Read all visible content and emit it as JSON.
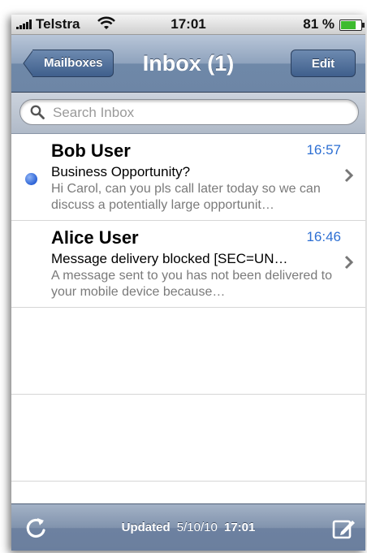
{
  "status_bar": {
    "carrier": "Telstra",
    "time": "17:01",
    "battery_percent": "81 %",
    "battery_level": 0.81,
    "icons": [
      "signal-icon",
      "wifi-icon",
      "battery-icon"
    ]
  },
  "nav": {
    "back_label": "Mailboxes",
    "title": "Inbox (1)",
    "edit_label": "Edit"
  },
  "search": {
    "placeholder": "Search Inbox"
  },
  "messages": [
    {
      "sender": "Bob User",
      "time": "16:57",
      "subject": "Business Opportunity?",
      "preview": "Hi Carol, can you pls call later today so we can discuss a potentially large opportunit…",
      "unread": true
    },
    {
      "sender": "Alice User",
      "time": "16:46",
      "subject": "Message delivery blocked [SEC=UN…",
      "preview": "A message sent to you has not been delivered to your mobile device because…",
      "unread": false
    }
  ],
  "toolbar": {
    "updated_label": "Updated",
    "updated_date": "5/10/10",
    "updated_time": "17:01",
    "icons": [
      "refresh-icon",
      "compose-icon"
    ]
  },
  "colors": {
    "accent_blue": "#2d6fd3",
    "unread_dot": "#2c63d6",
    "nav_bar": "#8fa3bd"
  }
}
